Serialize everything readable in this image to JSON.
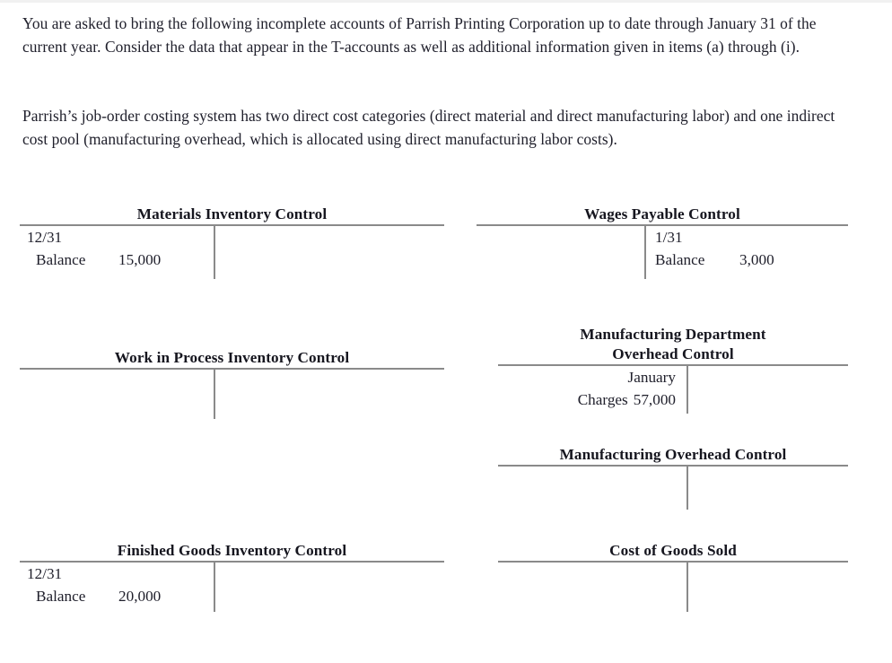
{
  "document": {
    "type": "accounting-problem",
    "paragraphs": [
      "You are asked to bring the following incomplete accounts of Parrish Printing Corporation up to date through January 31 of the current year. Consider the data that appear in the T-accounts as well as additional information given in items (a) through (i).",
      "Parrish’s job-order costing system has two direct cost categories (direct material and direct manufacturing labor) and one indirect cost pool (manufacturing overhead, which is allocated using direct manufacturing labor costs)."
    ]
  },
  "accounts": [
    {
      "id": "materials-inventory-control",
      "title": "Materials Inventory Control",
      "debit": {
        "date": "12/31",
        "label": "Balance",
        "amount": "15,000"
      },
      "credit": {
        "date": "",
        "label": "",
        "amount": ""
      }
    },
    {
      "id": "wages-payable-control",
      "title": "Wages Payable Control",
      "debit": {
        "date": "",
        "label": "",
        "amount": ""
      },
      "credit": {
        "date": "1/31",
        "label": "Balance",
        "amount": "3,000"
      }
    },
    {
      "id": "work-in-process-inventory-control",
      "title": "Work in Process Inventory Control",
      "debit": {
        "date": "",
        "label": "",
        "amount": ""
      },
      "credit": {
        "date": "",
        "label": "",
        "amount": ""
      }
    },
    {
      "id": "manufacturing-department-overhead-control",
      "title_line1": "Manufacturing Department",
      "title_line2": "Overhead Control",
      "title": "Manufacturing Department Overhead Control",
      "debit": {
        "date": "January",
        "label": "Charges",
        "amount": "57,000"
      },
      "credit": {
        "date": "",
        "label": "",
        "amount": ""
      }
    },
    {
      "id": "manufacturing-overhead-control",
      "title": "Manufacturing Overhead Control",
      "debit": {
        "date": "",
        "label": "",
        "amount": ""
      },
      "credit": {
        "date": "",
        "label": "",
        "amount": ""
      }
    },
    {
      "id": "finished-goods-inventory-control",
      "title": "Finished Goods Inventory Control",
      "debit": {
        "date": "12/31",
        "label": "Balance",
        "amount": "20,000"
      },
      "credit": {
        "date": "",
        "label": "",
        "amount": ""
      }
    },
    {
      "id": "cost-of-goods-sold",
      "title": "Cost of Goods Sold",
      "debit": {
        "date": "",
        "label": "",
        "amount": ""
      },
      "credit": {
        "date": "",
        "label": "",
        "amount": ""
      }
    }
  ],
  "colors": {
    "text": "#20202c",
    "rule": "#8a8a8a",
    "background": "#ffffff"
  }
}
